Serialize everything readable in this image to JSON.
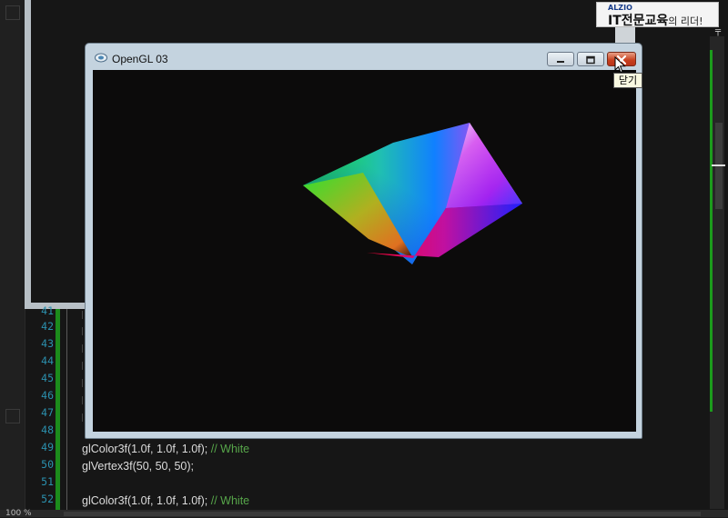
{
  "window": {
    "title": "OpenGL 03",
    "close_tooltip": "닫기"
  },
  "ad": {
    "brand": "ALZIO",
    "headline": "IT전문교육",
    "tagline": "의 리더!"
  },
  "editor": {
    "zoom": "100 %",
    "line_numbers": [
      "41",
      "42",
      "43",
      "44",
      "45",
      "46",
      "47",
      "48",
      "49",
      "50",
      "51",
      "52"
    ],
    "code_lines": [
      {
        "code": "glColor3f(1.0f, 1.0f, 1.0f); ",
        "comment": "// White"
      },
      {
        "code": "glVertex3f(50, 50, 50);",
        "comment": ""
      },
      {
        "code": "",
        "comment": ""
      },
      {
        "code": "glColor3f(1.0f, 1.0f, 1.0f); ",
        "comment": "// White"
      }
    ]
  },
  "colors": {
    "line_number": "#2b91af",
    "comment": "#57a64a",
    "change_bar": "#1c8c1c",
    "close_button": "#c73e1d"
  }
}
